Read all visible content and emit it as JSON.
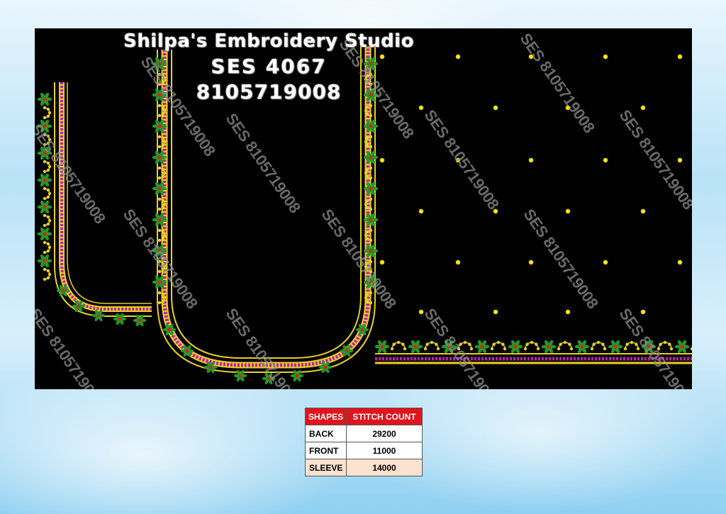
{
  "header": {
    "studio_name": "Shilpa's Embroidery Studio",
    "design_code": "SES  4067",
    "phone": "8105719008"
  },
  "watermark": "SES 8105719008",
  "colors": {
    "canvas": "#000000",
    "gold_border": "#e6d21e",
    "magenta_beads": "#c219b4",
    "green_flowers": "#1f9b2a",
    "red_centers": "#e01e1e",
    "yellow_dots": "#f2e600",
    "table_header": "#e1141c"
  },
  "icons": [
    "embroidery-neckline-back",
    "embroidery-neckline-front",
    "embroidery-sleeve-border",
    "polka-dot-motif"
  ],
  "table": {
    "headers": [
      "SHAPES",
      "STITCH COUNT"
    ],
    "rows": [
      {
        "shape": "BACK",
        "count": "29200"
      },
      {
        "shape": "FRONT",
        "count": "11000"
      },
      {
        "shape": "SLEEVE",
        "count": "14000"
      }
    ]
  }
}
